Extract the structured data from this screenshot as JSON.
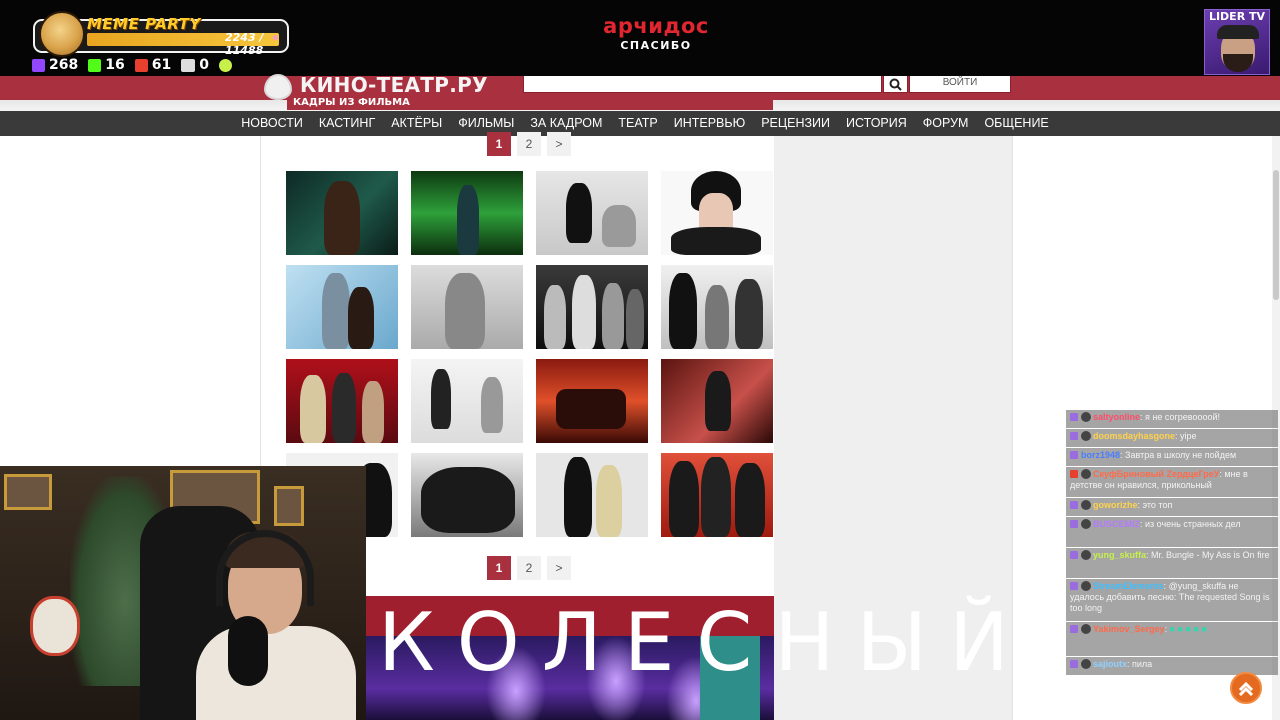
{
  "overlay": {
    "meme_title": "MEME PARTY",
    "meme_count": "2243 / 11488",
    "stats": [
      {
        "icon": "twitch-icon",
        "value": "268",
        "color": "#9146ff"
      },
      {
        "icon": "kick-icon",
        "value": "16",
        "color": "#53fc18"
      },
      {
        "icon": "vk-live-icon",
        "value": "61",
        "color": "#e8402f"
      },
      {
        "icon": "w-icon",
        "value": "0",
        "color": "#ffffff"
      },
      {
        "icon": "d-icon",
        "value": "",
        "color": "#c8f04a"
      }
    ],
    "sponsor_name": "арчидос",
    "sponsor_thanks": "СПАСИБО",
    "streamer_label": "LIDER TV"
  },
  "site": {
    "logo": "КИНО-ТЕАТР.РУ",
    "section": "КАДРЫ ИЗ ФИЛЬМА",
    "login": "ВОЙТИ",
    "accent": "#a8303f",
    "nav": [
      "НОВОСТИ",
      "КАСТИНГ",
      "АКТЁРЫ",
      "ФИЛЬМЫ",
      "ЗА КАДРОМ",
      "ТЕАТР",
      "ИНТЕРВЬЮ",
      "РЕЦЕНЗИИ",
      "ИСТОРИЯ",
      "ФОРУМ",
      "ОБЩЕНИЕ"
    ]
  },
  "pager": {
    "pages": [
      "1",
      "2"
    ],
    "next": ">",
    "current": "1"
  },
  "gallery": {
    "rows": 4,
    "cols": 4,
    "count": 16
  },
  "video": {
    "title_text": "КОЛЕСНЫЙ"
  },
  "chat": [
    {
      "user": "saltyonline",
      "text": "я не согревоооой!",
      "color": "#ff4d6a"
    },
    {
      "user": "doomsdayhasgone",
      "text": "yipe",
      "color": "#ffd24a"
    },
    {
      "user": "borz1948",
      "text": "Завтра в школу не пойдем",
      "color": "#4a7dff"
    },
    {
      "user": "СкуфБриновый ZердцеГреУ",
      "text": "мне в детстве он нравился, прикольный",
      "color": "#ff6a4a"
    },
    {
      "user": "goworizhe",
      "text": "это топ",
      "color": "#ffd24a"
    },
    {
      "user": "BUSCEMIZ",
      "text": "из очень странных дел",
      "color": "#b47aff"
    },
    {
      "user": "yung_skuffa",
      "text": "Mr. Bungle - My Ass is On fire",
      "color": "#c8f04a"
    },
    {
      "user": "StreamElements",
      "text": "@yung_skuffa не удалось добавить песню: The requested Song is too long",
      "color": "#3fbfff"
    },
    {
      "user": "Yakimov_Sergey",
      "text": "",
      "color": "#ff6a4a"
    },
    {
      "user": "sajioutx",
      "text": "пила",
      "color": "#8fd0ff"
    }
  ]
}
